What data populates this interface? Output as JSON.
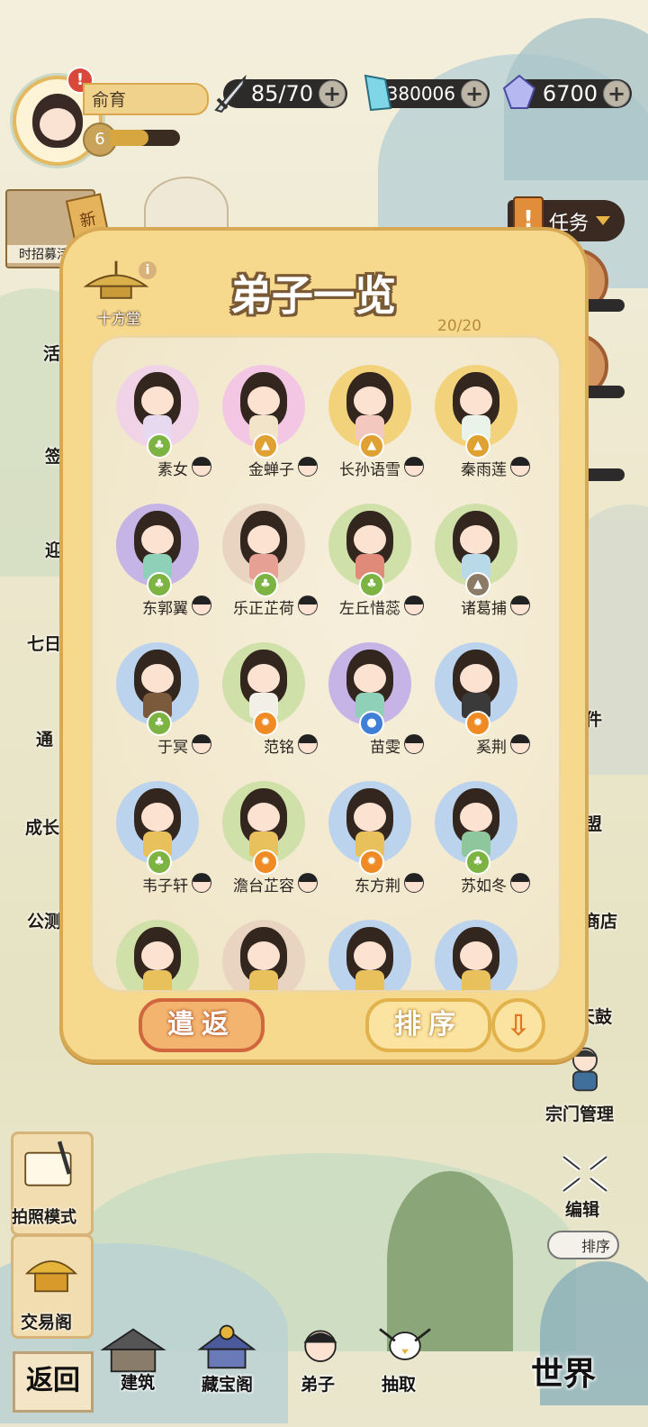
{
  "player": {
    "name": "俞育",
    "level": "6",
    "exp_fraction": 0.55,
    "alert_mark": "!"
  },
  "resources": {
    "stamina": "85/70",
    "spirit_stone": "380006",
    "gem": "6700",
    "plus": "+"
  },
  "left_panel": {
    "recruit_tag": "新",
    "recruit_caption": "时招募活动",
    "labels": [
      "活",
      "签",
      "迎",
      "七日",
      "通",
      "成长",
      "公测"
    ],
    "photo_mode": "拍照模式",
    "trade_hall": "交易阁",
    "back": "返回"
  },
  "right_panel": {
    "task_mark": "!",
    "task_label": "任务",
    "labels": [
      "件",
      "盟",
      "商店",
      "天鼓"
    ],
    "sect_manage": "宗门管理",
    "edit": "编辑",
    "sort": "排序",
    "world": "世界"
  },
  "dock": {
    "build": "建筑",
    "treasure": "藏宝阁",
    "disciple": "弟子",
    "draw": "抽取"
  },
  "modal": {
    "title": "弟子一览",
    "hall_name": "十方堂",
    "info_mark": "i",
    "count": "20/20",
    "dismiss_button": "遣返",
    "sort_button": "排序",
    "sort_arrow": "⇩",
    "disciples": [
      {
        "name": "素女",
        "element": "wood",
        "portrait_color": "#f0d3e6",
        "outfit_color": "#e6d9f0"
      },
      {
        "name": "金蝉子",
        "element": "earth",
        "portrait_color": "#f3c6e3",
        "outfit_color": "#f1e4c9"
      },
      {
        "name": "长孙语雪",
        "element": "earth",
        "portrait_color": "#f2d37c",
        "outfit_color": "#f3c9bf"
      },
      {
        "name": "秦雨莲",
        "element": "earth",
        "portrait_color": "#f2d37c",
        "outfit_color": "#e9f3ea"
      },
      {
        "name": "东郭翼",
        "element": "wood",
        "portrait_color": "#c7b4e6",
        "outfit_color": "#8fd0b9"
      },
      {
        "name": "乐正芷荷",
        "element": "wood",
        "portrait_color": "#e8d4c0",
        "outfit_color": "#e6a094"
      },
      {
        "name": "左丘惜蕊",
        "element": "wood",
        "portrait_color": "#cfe0a8",
        "outfit_color": "#e08a7a"
      },
      {
        "name": "诸葛捕",
        "element": "mountain",
        "portrait_color": "#cfe0a8",
        "outfit_color": "#b7d9e8"
      },
      {
        "name": "于冥",
        "element": "wood",
        "portrait_color": "#bcd3ee",
        "outfit_color": "#7a5a3a"
      },
      {
        "name": "范铭",
        "element": "fire",
        "portrait_color": "#cfe0a8",
        "outfit_color": "#f1efe6"
      },
      {
        "name": "苗雯",
        "element": "water",
        "portrait_color": "#c7b4e6",
        "outfit_color": "#8fd0b9"
      },
      {
        "name": "奚荆",
        "element": "fire",
        "portrait_color": "#bcd3ee",
        "outfit_color": "#3a3a3a"
      },
      {
        "name": "韦子轩",
        "element": "wood",
        "portrait_color": "#bcd3ee",
        "outfit_color": "#e8c15c"
      },
      {
        "name": "澹台芷容",
        "element": "fire",
        "portrait_color": "#cfe0a8",
        "outfit_color": "#e8c15c"
      },
      {
        "name": "东方荆",
        "element": "fire",
        "portrait_color": "#bcd3ee",
        "outfit_color": "#e8c15c"
      },
      {
        "name": "苏如冬",
        "element": "wood",
        "portrait_color": "#bcd3ee",
        "outfit_color": "#8fc79c"
      },
      {
        "name": "",
        "element": "",
        "portrait_color": "#cfe0a8",
        "outfit_color": "#e8c15c"
      },
      {
        "name": "",
        "element": "",
        "portrait_color": "#e8d4c0",
        "outfit_color": "#e8c15c"
      },
      {
        "name": "",
        "element": "",
        "portrait_color": "#bcd3ee",
        "outfit_color": "#e8c15c"
      },
      {
        "name": "",
        "element": "",
        "portrait_color": "#bcd3ee",
        "outfit_color": "#e8c15c"
      }
    ]
  },
  "colors": {
    "wood": "#7cb342",
    "earth": "#e0a133",
    "fire": "#f08a24",
    "water": "#3f7fd6",
    "mountain": "#8b7a66"
  }
}
